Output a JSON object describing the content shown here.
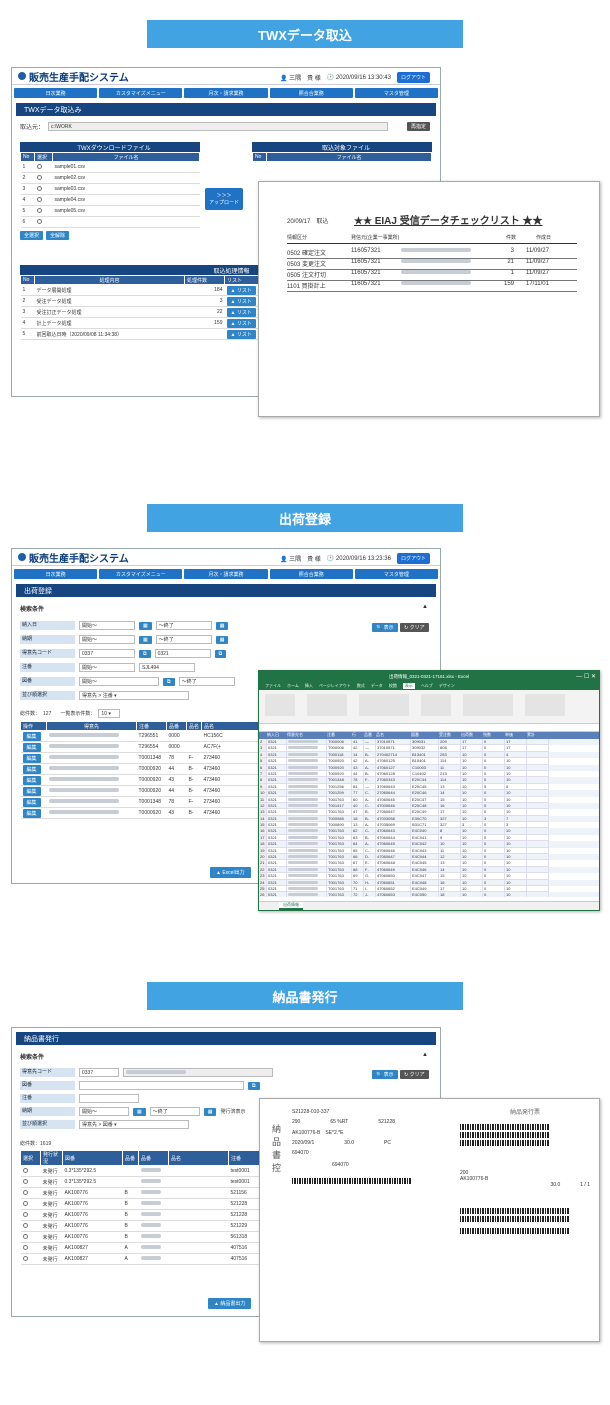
{
  "sections": {
    "twx": "TWXデータ取込",
    "ship": "出荷登録",
    "deliv": "納品書発行"
  },
  "app": {
    "title": "販売生産手配システム",
    "user": "三隅　貴 様",
    "time1": "2020/09/16 13:30:43",
    "time2": "2020/09/16 13:23:36",
    "logout": "ログアウト",
    "menu": [
      "日次業務",
      "カスタマイズメニュー",
      "月次・請求業務",
      "照合合業務",
      "マスタ管理"
    ],
    "copyright": "Copyright © T.S.Networks, Ltd. All Rights R"
  },
  "twx": {
    "section_title": "TWXデータ取込み",
    "path_label": "取込元：",
    "path_value": "c:\\WORK",
    "change_btn": "再指定",
    "download_title": "TWXダウンロードファイル",
    "target_title": "取込対象ファイル",
    "col_no": "No",
    "col_select": "選択",
    "col_filename": "ファイル名",
    "files": [
      {
        "no": "1",
        "name": "sample01.csv"
      },
      {
        "no": "2",
        "name": "sample02.csv"
      },
      {
        "no": "3",
        "name": "sample03.csv"
      },
      {
        "no": "4",
        "name": "sample04.csv"
      },
      {
        "no": "5",
        "name": "sample05.csv"
      },
      {
        "no": "6",
        "name": ""
      }
    ],
    "select_all": "全選択",
    "deselect_all": "全解除",
    "upload_btn": "アップロード",
    "upload_arrows": "＞＞＞",
    "proc_title": "取込処理情報",
    "proc_col_no": "No",
    "proc_col_content": "処理内容",
    "proc_col_count": "処理件数",
    "proc_col_list": "リスト",
    "procs": [
      {
        "no": "1",
        "content": "データ展開処理",
        "count": "184"
      },
      {
        "no": "2",
        "content": "受注データ処理",
        "count": "3"
      },
      {
        "no": "3",
        "content": "受注訂正データ処理",
        "count": "22"
      },
      {
        "no": "4",
        "content": "計上データ処理",
        "count": "159"
      },
      {
        "no": "5",
        "content": "前回取込日時（2020/09/08 11:34:38）",
        "count": ""
      }
    ],
    "list_btn": "リスト"
  },
  "report": {
    "date": "20/09/17",
    "kind": "取込",
    "title": "★★ EIAJ 受信データチェックリスト ★★",
    "h_kind": "情報区分",
    "h_code": "発信元(企業一事業所)",
    "h_count": "件数",
    "h_date": "作成日",
    "rows": [
      {
        "code": "0502",
        "kind": "確定注文",
        "sender": "116057321",
        "count": "3",
        "date": "11/09/27"
      },
      {
        "code": "0503",
        "kind": "変更注文",
        "sender": "116057321",
        "count": "21",
        "date": "11/09/27"
      },
      {
        "code": "0505",
        "kind": "注文打切",
        "sender": "116057321",
        "count": "1",
        "date": "11/09/27"
      },
      {
        "code": "1101",
        "kind": "買掛計上",
        "sender": "116057321",
        "count": "159",
        "date": "17/11/01"
      }
    ]
  },
  "ship": {
    "section_title": "出荷登録",
    "cond_title": "検索条件",
    "labels": [
      "納入日",
      "納期",
      "得意先コード",
      "注番",
      "図番",
      "並び順選択"
    ],
    "start": "開始～",
    "end": "～終了",
    "cust_code": "0337",
    "cust_code2": "0321",
    "order_no": "SJL494",
    "sort_value": "得意先 > 注番",
    "search": "表示",
    "clear": "クリア",
    "total_label": "総件数：",
    "total": "127",
    "per_page_label": "一覧表示件数：",
    "per_page": "10",
    "col_op": "操作",
    "col_cust": "得意先",
    "col_order": "注番",
    "col_item": "品番",
    "col_kind": "品名",
    "col_name": "品名",
    "edit": "編集",
    "rows": [
      {
        "order": "T296551",
        "item": "0000",
        "k": "",
        "f": "",
        "n": "HC156C"
      },
      {
        "order": "T296554",
        "item": "0000",
        "k": "",
        "f": "",
        "n": "AC7F(+"
      },
      {
        "order": "T0001348",
        "item": "78",
        "k": "F-",
        "f": "",
        "n": "273460"
      },
      {
        "order": "T0000920",
        "item": "44",
        "k": "B-",
        "f": "",
        "n": "473460"
      },
      {
        "order": "T0000920",
        "item": "43",
        "k": "B-",
        "f": "",
        "n": "473460"
      },
      {
        "order": "T0000920",
        "item": "44",
        "k": "B-",
        "f": "",
        "n": "473460"
      },
      {
        "order": "T0001348",
        "item": "78",
        "k": "F-",
        "f": "",
        "n": "273460"
      },
      {
        "order": "T0000920",
        "item": "43",
        "k": "B-",
        "f": "",
        "n": "473460"
      }
    ],
    "excel_btn": "Excel出力"
  },
  "excel": {
    "title": "出荷情報_0321-0321-17161.xlsx - Excel",
    "tabs": [
      "ファイル",
      "ホーム",
      "挿入",
      "ページレイアウト",
      "数式",
      "データ",
      "校閲",
      "表示",
      "ヘルプ",
      "デザイン"
    ],
    "sheet": "出荷情報",
    "headers": [
      "納入日",
      "得意先名",
      "注番",
      "行",
      "品番",
      "品名",
      "図番",
      "受注数",
      "出荷数",
      "残数",
      "単価",
      "累計"
    ],
    "rows": [
      [
        "0321",
        "T000006",
        "41",
        "—",
        "37010571",
        "309031",
        "209",
        "17",
        "0",
        "17"
      ],
      [
        "0321",
        "T000006",
        "42",
        "—",
        "37010571",
        "309032",
        "608",
        "17",
        "0",
        "17"
      ],
      [
        "0321",
        "T000118",
        "14",
        "B-",
        "270402714",
        "B13401",
        "253",
        "10",
        "0",
        "4"
      ],
      [
        "0321",
        "T000920",
        "42",
        "A-",
        "47060125",
        "B10401",
        "114",
        "10",
        "0",
        "10"
      ],
      [
        "0321",
        "T000920",
        "43",
        "A-",
        "47060127",
        "C10003",
        "11",
        "10",
        "0",
        "10"
      ],
      [
        "0321",
        "T000920",
        "44",
        "B-",
        "47060128",
        "C10402",
        "213",
        "10",
        "0",
        "10"
      ],
      [
        "0321",
        "T001348",
        "78",
        "F-",
        "27060343",
        "E20C44",
        "114",
        "10",
        "0",
        "10"
      ],
      [
        "0321",
        "T001256",
        "84",
        "—",
        "37060643",
        "E20C45",
        "13",
        "10",
        "5",
        "5"
      ],
      [
        "0321",
        "T001259",
        "77",
        "C-",
        "27060644",
        "E20C46",
        "14",
        "10",
        "0",
        "10"
      ],
      [
        "0321",
        "T001763",
        "60",
        "A-",
        "47060645",
        "E20C47",
        "15",
        "10",
        "0",
        "10"
      ],
      [
        "0321",
        "T001417",
        "40",
        "C-",
        "47000646",
        "E20C48",
        "16",
        "10",
        "0",
        "10"
      ],
      [
        "0321",
        "T001763",
        "47",
        "B-",
        "27060647",
        "E20C49",
        "17",
        "10",
        "0",
        "10"
      ],
      [
        "0321",
        "T000985",
        "18",
        "B-",
        "47033058",
        "E30C70",
        "327",
        "10",
        "3",
        "7"
      ],
      [
        "0321",
        "T000890",
        "13",
        "A-",
        "47035069",
        "B31C71",
        "327",
        "3",
        "0",
        "3"
      ],
      [
        "0321",
        "T001763",
        "62",
        "C-",
        "47060643",
        "E4C040",
        "8",
        "10",
        "0",
        "10"
      ],
      [
        "0321",
        "T001763",
        "63",
        "B-",
        "47060644",
        "E4C041",
        "9",
        "10",
        "0",
        "10"
      ],
      [
        "0321",
        "T001763",
        "64",
        "A-",
        "47060645",
        "E4C042",
        "10",
        "10",
        "0",
        "10"
      ],
      [
        "0321",
        "T001763",
        "65",
        "C-",
        "47060646",
        "E4C043",
        "11",
        "10",
        "0",
        "10"
      ],
      [
        "0321",
        "T001763",
        "66",
        "D-",
        "47060647",
        "E4C044",
        "12",
        "10",
        "0",
        "10"
      ],
      [
        "0321",
        "T001763",
        "67",
        "E-",
        "47060648",
        "E4C045",
        "13",
        "10",
        "0",
        "10"
      ],
      [
        "0321",
        "T001763",
        "68",
        "F-",
        "47060649",
        "E4C046",
        "14",
        "10",
        "0",
        "10"
      ],
      [
        "0321",
        "T001763",
        "69",
        "G-",
        "47060650",
        "E4C047",
        "15",
        "10",
        "0",
        "10"
      ],
      [
        "0321",
        "T001763",
        "70",
        "H-",
        "47060651",
        "E4C048",
        "16",
        "10",
        "0",
        "10"
      ],
      [
        "0321",
        "T001763",
        "71",
        "I-",
        "47060652",
        "E4C049",
        "17",
        "10",
        "0",
        "10"
      ],
      [
        "0321",
        "T001763",
        "72",
        "J-",
        "47060653",
        "E4C050",
        "18",
        "10",
        "0",
        "10"
      ]
    ]
  },
  "deliv": {
    "section_title": "納品書発行",
    "cond_title": "検索条件",
    "labels": [
      "得意先コード",
      "図番",
      "注番",
      "納期",
      "並び順選択"
    ],
    "cust_code": "0337",
    "start": "開始～",
    "end": "～終了",
    "issue_status": "発行済表示",
    "sort_value": "得意先 > 図番",
    "search": "表示",
    "clear": "クリア",
    "total_label": "総件数：",
    "total": "1619",
    "col_sel": "選択",
    "col_status": "発行状況",
    "col_fig": "図番",
    "col_item": "品番",
    "col_kind": "品番",
    "col_name": "品名",
    "col_code": "注番",
    "rows": [
      {
        "status": "未発行",
        "fig": "0.3*135*292.5",
        "item": "",
        "kind": "",
        "code": "test0001"
      },
      {
        "status": "未発行",
        "fig": "0.3*135*292.5",
        "item": "",
        "kind": "",
        "code": "test0001"
      },
      {
        "status": "未発行",
        "fig": "AK100776",
        "item": "B",
        "kind": "",
        "code": "521156"
      },
      {
        "status": "未発行",
        "fig": "AK100776",
        "item": "B",
        "kind": "",
        "code": "521228"
      },
      {
        "status": "未発行",
        "fig": "AK100776",
        "item": "B",
        "kind": "",
        "code": "521228"
      },
      {
        "status": "未発行",
        "fig": "AK100776",
        "item": "B",
        "kind": "",
        "code": "521229"
      },
      {
        "status": "未発行",
        "fig": "AK100776",
        "item": "B",
        "kind": "",
        "code": "561318"
      },
      {
        "status": "未発行",
        "fig": "AK100827",
        "item": "A",
        "kind": "",
        "code": "407516"
      },
      {
        "status": "未発行",
        "fig": "AK100827",
        "item": "A",
        "kind": "",
        "code": "407516"
      }
    ],
    "print_btn": "納品書出力"
  },
  "slip": {
    "code1": "S21228-010-337",
    "v1": "290",
    "v2": "65 %RT",
    "v3": "521228",
    "part": "AK100776-B",
    "note": "SE*2.*E",
    "date": "2020/09/1",
    "qty": "30.0",
    "unit": "PC",
    "num": "694070",
    "num2": "694070",
    "side": "納品書控",
    "title2": "納品発行票",
    "v4": "200",
    "part2": "AK100776-B",
    "qty2": "30.0",
    "page": "1 / 1"
  },
  "colors": {
    "banner": "#42a3e3",
    "menu": "#1f72c4",
    "section": "#16457f",
    "table_header": "#2f5f9a",
    "excel_green": "#217346"
  }
}
